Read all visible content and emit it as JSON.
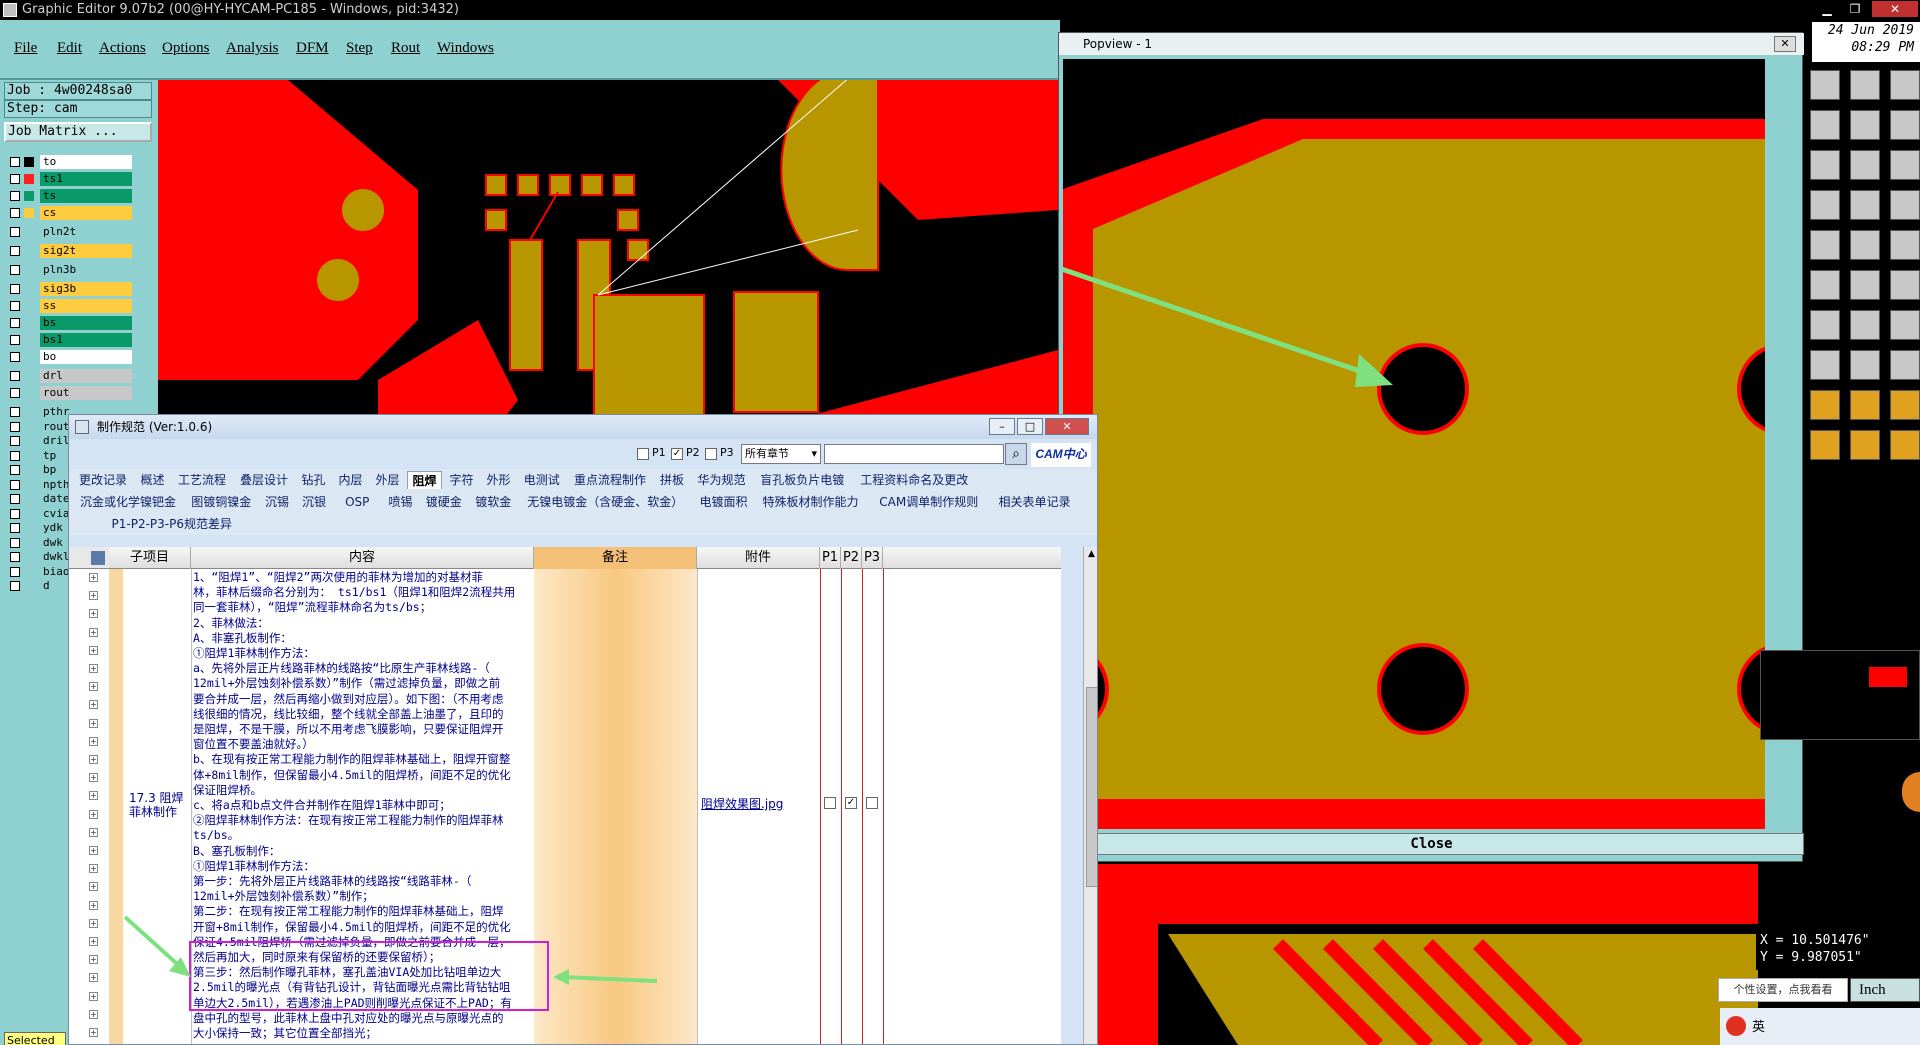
{
  "window": {
    "title": "Graphic Editor 9.07b2 (00@HY-HYCAM-PC185 - Windows, pid:3432)",
    "date": "24 Jun 2019",
    "time": "08:29 PM"
  },
  "menu": [
    "File",
    "Edit",
    "Actions",
    "Options",
    "Analysis",
    "DFM",
    "Step",
    "Rout",
    "Windows"
  ],
  "job": {
    "job_label": "Job : 4w00248sa0",
    "step_label": "Step: cam",
    "matrix_button": "Job Matrix ..."
  },
  "layers": [
    {
      "name": "to",
      "color": "#ffffff",
      "mark": "#000000"
    },
    {
      "name": "ts1",
      "color": "#0a9a6a",
      "mark": "#ff2020"
    },
    {
      "name": "ts",
      "color": "#0a9a6a",
      "mark": "#0a9a6a"
    },
    {
      "name": "cs",
      "color": "#ffcc40",
      "mark": "#ffcc40"
    },
    {
      "name": "pln2t",
      "color": "#8fd0d0",
      "mark": "#8fd0d0"
    },
    {
      "name": "sig2t",
      "color": "#ffcc40",
      "mark": "#8fd0d0"
    },
    {
      "name": "pln3b",
      "color": "#8fd0d0",
      "mark": "#8fd0d0"
    },
    {
      "name": "sig3b",
      "color": "#ffcc40",
      "mark": "#8fd0d0"
    },
    {
      "name": "ss",
      "color": "#ffcc40",
      "mark": "#8fd0d0"
    },
    {
      "name": "bs",
      "color": "#0a9a6a",
      "mark": "#8fd0d0"
    },
    {
      "name": "bs1",
      "color": "#0a9a6a",
      "mark": "#8fd0d0"
    },
    {
      "name": "bo",
      "color": "#ffffff",
      "mark": "#8fd0d0"
    },
    {
      "name": "drl",
      "color": "#c8c8c8",
      "mark": "#8fd0d0"
    },
    {
      "name": "rout",
      "color": "#c8c8c8",
      "mark": "#8fd0d0"
    },
    {
      "name": "pthr",
      "color": "#8fd0d0",
      "mark": "#8fd0d0"
    },
    {
      "name": "rout",
      "color": "#8fd0d0",
      "mark": "#8fd0d0"
    },
    {
      "name": "dril",
      "color": "#8fd0d0",
      "mark": "#8fd0d0"
    },
    {
      "name": "tp",
      "color": "#8fd0d0",
      "mark": "#8fd0d0"
    },
    {
      "name": "bp",
      "color": "#8fd0d0",
      "mark": "#8fd0d0"
    },
    {
      "name": "npth",
      "color": "#8fd0d0",
      "mark": "#8fd0d0"
    },
    {
      "name": "date",
      "color": "#8fd0d0",
      "mark": "#8fd0d0"
    },
    {
      "name": "cvia",
      "color": "#8fd0d0",
      "mark": "#8fd0d0"
    },
    {
      "name": "ydk",
      "color": "#8fd0d0",
      "mark": "#8fd0d0"
    },
    {
      "name": "dwk",
      "color": "#8fd0d0",
      "mark": "#8fd0d0"
    },
    {
      "name": "dwkl",
      "color": "#8fd0d0",
      "mark": "#8fd0d0"
    },
    {
      "name": "biao",
      "color": "#8fd0d0",
      "mark": "#8fd0d0"
    },
    {
      "name": "d",
      "color": "#8fd0d0",
      "mark": "#8fd0d0"
    }
  ],
  "selected_label": "Selected",
  "popview": {
    "title": "Popview - 1",
    "close_label": "Close"
  },
  "coords": {
    "x": "X = 10.501476\"",
    "y": "Y = 9.987051\""
  },
  "units": "Inch",
  "ime_hint": "个性设置，点我看看",
  "dialog": {
    "title": "制作规范 (Ver:1.0.6)",
    "filters": [
      "P1",
      "P2",
      "P3"
    ],
    "chapter_select": "所有章节",
    "logo": "CAM中心",
    "tabs_row1": [
      "更改记录",
      "概述",
      "工艺流程",
      "叠层设计",
      "钻孔",
      "内层",
      "外层",
      "阻焊",
      "字符",
      "外形",
      "电测试",
      "重点流程制作",
      "拼板",
      "华为规范",
      "盲孔板负片电镀",
      "工程资料命名及更改"
    ],
    "tabs_row2": [
      "沉金或化学镍钯金",
      "图镀铜镍金",
      "沉锡",
      "沉银",
      "OSP",
      "喷锡",
      "镀硬金",
      "镀软金",
      "无镍电镀金（含硬金、软金）",
      "电镀面积",
      "特殊板材制作能力",
      "CAM调单制作规则",
      "相关表单记录"
    ],
    "tabs_row3": [
      "P1-P2-P3-P6规范差异"
    ],
    "columns": [
      "子项目",
      "内容",
      "备注",
      "附件",
      "P1",
      "P2",
      "P3"
    ],
    "row": {
      "subitem": "17.3 阻焊菲林制作",
      "attachment": "阻焊效果图.jpg",
      "content": [
        "1、“阻焊1”、“阻焊2”两次使用的菲林为增加的对基材菲",
        "林，菲林后缀命名分别为： ts1/bs1（阻焊1和阻焊2流程共用",
        "同一套菲林），“阻焊”流程菲林命名为ts/bs；",
        "2、菲林做法：",
        "A、非塞孔板制作：",
        "①阻焊1菲林制作方法：",
        "a、先将外层正片线路菲林的线路按“比原生产菲林线路-（",
        "12mil+外层蚀刻补偿系数）”制作（需过滤掉负量，即做之前",
        "要合并成一层，然后再缩小做到对应层）。如下图：（不用考虑",
        "线很细的情况，线比较细，整个线就全部盖上油墨了，且印的",
        "是阻焊，不是干膜，所以不用考虑飞膜影响，只要保证阻焊开",
        "窗位置不要盖油就好。）",
        "b、在现有按正常工程能力制作的阻焊菲林基础上，阻焊开窗整",
        "体+8mil制作，但保留最小4.5mil的阻焊桥，间距不足的优化",
        "保证阻焊桥。",
        "c、将a点和b点文件合并制作在阻焊1菲林中即可；",
        "②阻焊菲林制作方法：在现有按正常工程能力制作的阻焊菲林",
        "ts/bs。",
        "B、塞孔板制作：",
        "①阻焊1菲林制作方法：",
        "第一步：先将外层正片线路菲林的线路按“线路菲林-（",
        "12mil+外层蚀刻补偿系数）”制作；",
        "第二步：在现有按正常工程能力制作的阻焊菲林基础上，阻焊",
        "开窗+8mil制作，保留最小4.5mil的阻焊桥，间距不足的优化",
        "保证4.5mil阻焊桥（需过滤掉负量，即做之前要合并成一层，",
        "然后再加大，同时原来有保留桥的还要保留桥）；",
        "第三步：然后制作曝孔菲林，塞孔盖油VIA处加比钻咀单边大",
        "2.5mil的曝光点（有背钻孔设计，背钻面曝光点需比背钻钻咀",
        "单边大2.5mil），若遇渗油上PAD则削曝光点保证不上PAD；有",
        "盘中孔的型号，此菲林上盘中孔对应处的曝光点与原曝光点的",
        "大小保持一致；其它位置全部挡光；"
      ]
    }
  },
  "colors": {
    "cyan_ui": "#8fd0d0",
    "copper": "#b89600",
    "red": "#ff0000",
    "highlight": "#d020d0",
    "arrow": "#7fe07f"
  }
}
